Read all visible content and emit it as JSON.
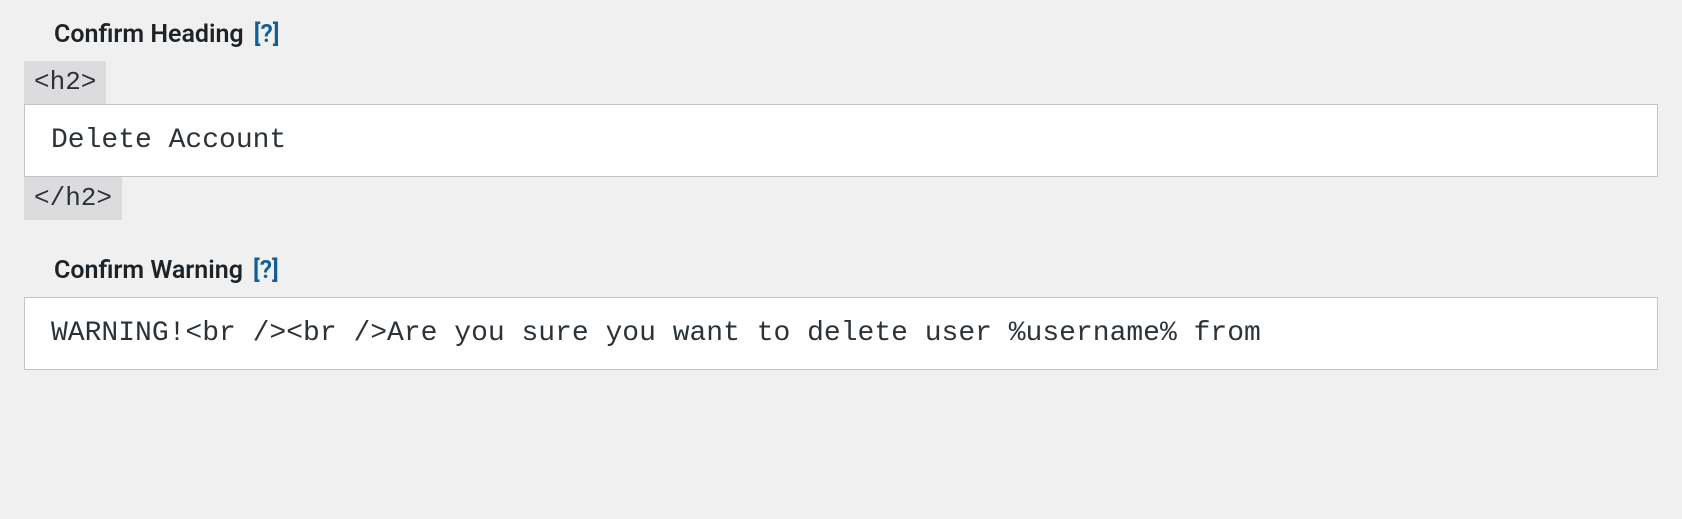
{
  "confirm_heading": {
    "label": "Confirm Heading",
    "help": "[?]",
    "tag_open": "<h2>",
    "tag_close": "</h2>",
    "value": "Delete Account"
  },
  "confirm_warning": {
    "label": "Confirm Warning",
    "help": "[?]",
    "value": "WARNING!<br /><br />Are you sure you want to delete user %username% from"
  }
}
